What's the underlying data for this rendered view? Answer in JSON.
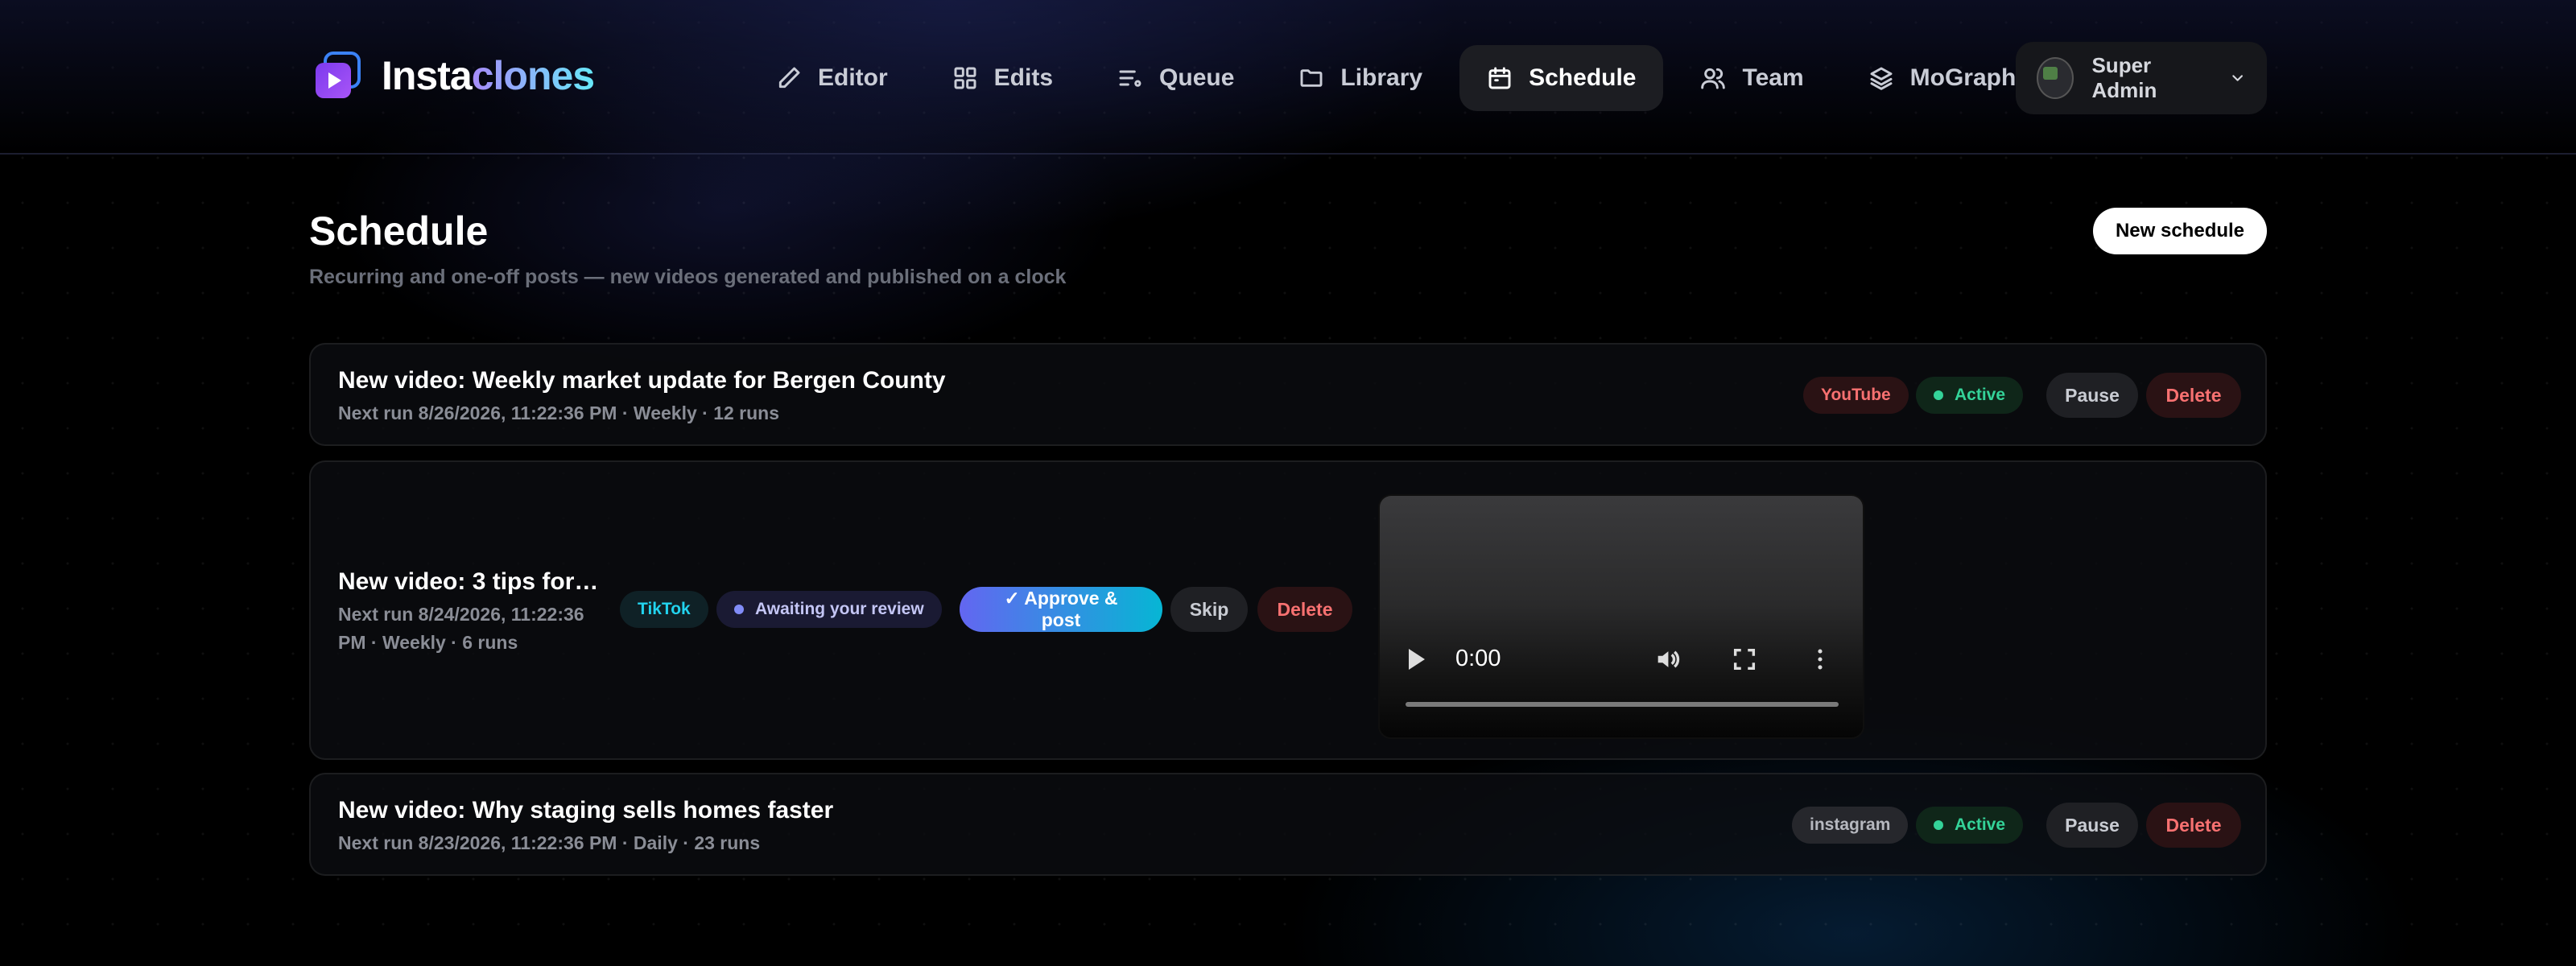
{
  "brand": {
    "name_part1": "Insta",
    "name_part2": "clones"
  },
  "nav": [
    {
      "id": "editor",
      "label": "Editor",
      "icon": "pencil-icon",
      "active": false
    },
    {
      "id": "edits",
      "label": "Edits",
      "icon": "grid-icon",
      "active": false
    },
    {
      "id": "queue",
      "label": "Queue",
      "icon": "list-icon",
      "active": false
    },
    {
      "id": "library",
      "label": "Library",
      "icon": "folder-icon",
      "active": false
    },
    {
      "id": "schedule",
      "label": "Schedule",
      "icon": "calendar-icon",
      "active": true
    },
    {
      "id": "team",
      "label": "Team",
      "icon": "users-icon",
      "active": false
    },
    {
      "id": "mograph",
      "label": "MoGraph",
      "icon": "layers-icon",
      "active": false
    }
  ],
  "user": {
    "name": "Super Admin",
    "icon": "chevron-down-icon"
  },
  "page": {
    "title": "Schedule",
    "subtitle": "Recurring and one-off posts — new videos generated and published on a clock",
    "new_button": "New schedule"
  },
  "schedules": [
    {
      "title": "New video: Weekly market update for Bergen County",
      "meta": "Next run 8/26/2026, 11:22:36 PM · Weekly · 12 runs",
      "platform": "YouTube",
      "status": "Active",
      "pause_label": "Pause",
      "delete_label": "Delete"
    },
    {
      "title": "New video: 3 tips for …",
      "meta": "Next run 8/24/2026, 11:22:36 PM · Weekly · 6 runs",
      "platform": "TikTok",
      "status": "Awaiting your review",
      "approve_label": "✓ Approve & post",
      "skip_label": "Skip",
      "delete_label": "Delete",
      "video_time": "0:00"
    },
    {
      "title": "New video: Why staging sells homes faster",
      "meta": "Next run 8/23/2026, 11:22:36 PM · Daily · 23 runs",
      "platform": "instagram",
      "status": "Active",
      "pause_label": "Pause",
      "delete_label": "Delete"
    }
  ],
  "colors": {
    "accent_gradient_start": "#6366f1",
    "accent_gradient_end": "#06b6d4",
    "active_green": "#34d399",
    "danger_red": "#f87171",
    "tiktok_cyan": "#22d3ee"
  }
}
